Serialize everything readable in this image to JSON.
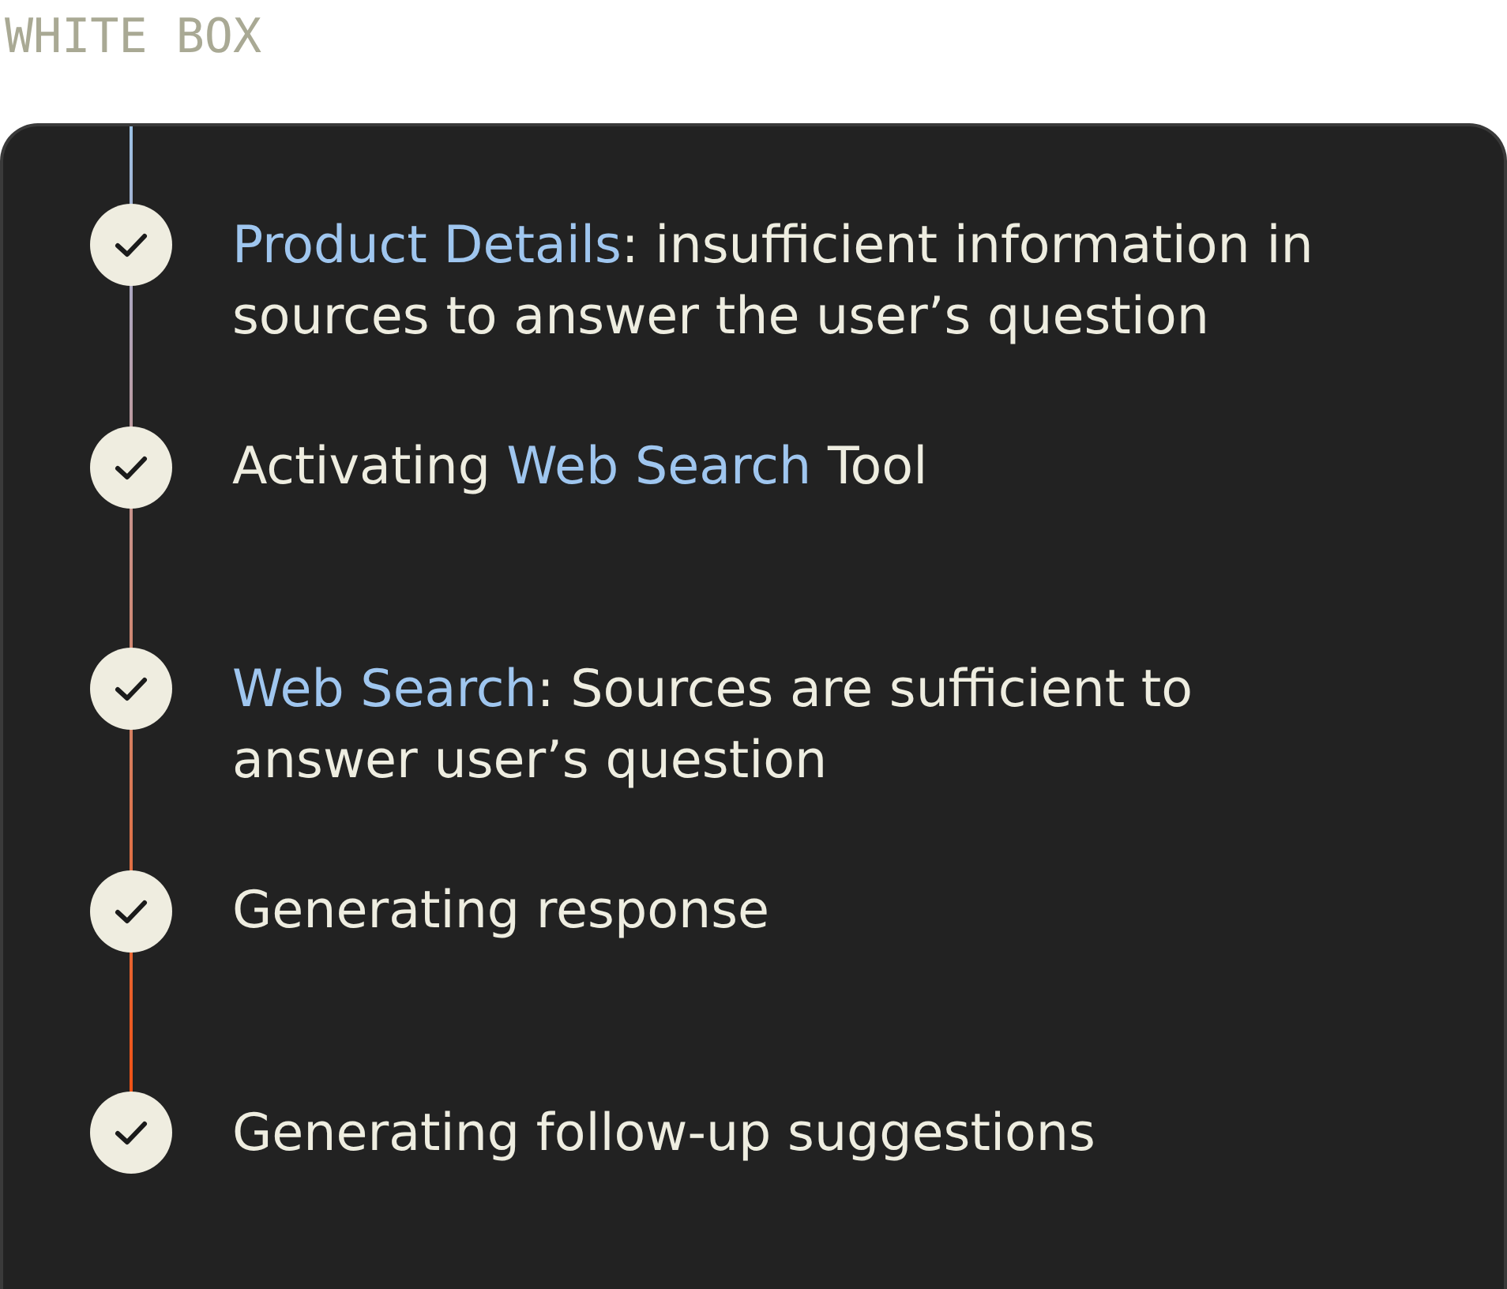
{
  "caption": "WHITE BOX",
  "steps": [
    {
      "completed": true,
      "segments": [
        {
          "kind": "highlight",
          "text": "Product Details"
        },
        {
          "kind": "plain",
          "text": ": insufficient information in sources to answer the user’s question"
        }
      ]
    },
    {
      "completed": true,
      "segments": [
        {
          "kind": "plain",
          "text": "Activating "
        },
        {
          "kind": "highlight",
          "text": "Web Search"
        },
        {
          "kind": "plain",
          "text": " Tool"
        }
      ]
    },
    {
      "completed": true,
      "segments": [
        {
          "kind": "highlight",
          "text": "Web Search"
        },
        {
          "kind": "plain",
          "text": ": Sources are sufficient to answer user’s question"
        }
      ]
    },
    {
      "completed": true,
      "segments": [
        {
          "kind": "plain",
          "text": "Generating response"
        }
      ]
    },
    {
      "completed": true,
      "segments": [
        {
          "kind": "plain",
          "text": "Generating follow-up suggestions"
        }
      ]
    }
  ]
}
